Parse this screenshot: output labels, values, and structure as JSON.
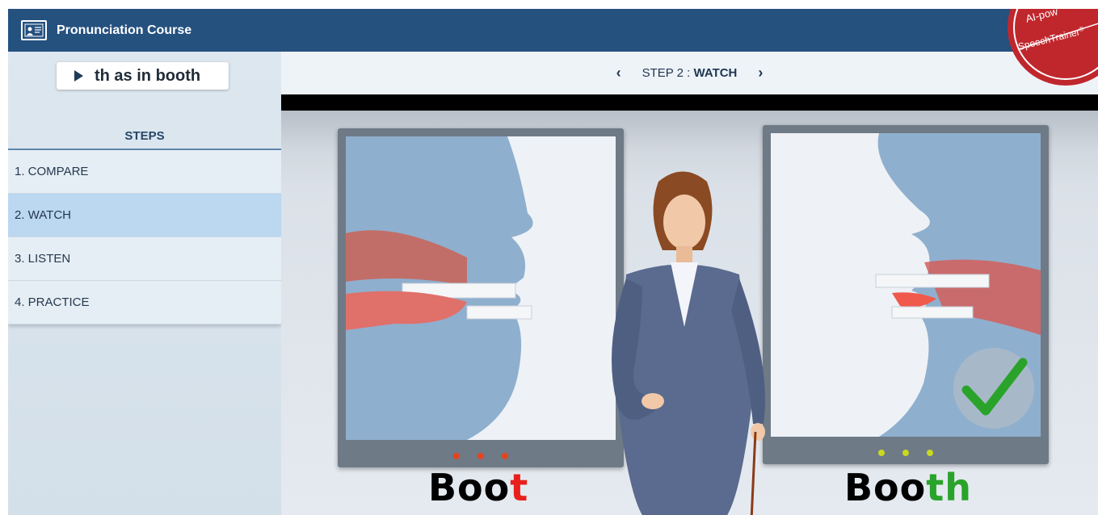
{
  "app": {
    "title": "Pronunciation Course"
  },
  "lesson": {
    "word_button_label": "th as in booth"
  },
  "sidebar": {
    "steps_heading": "STEPS",
    "steps": [
      {
        "label": "1. COMPARE",
        "active": false
      },
      {
        "label": "2. WATCH",
        "active": true
      },
      {
        "label": "3. LISTEN",
        "active": false
      },
      {
        "label": "4. PRACTICE",
        "active": false
      }
    ]
  },
  "step_nav": {
    "prev_icon": "chevron-left-icon",
    "next_icon": "chevron-right-icon",
    "prefix": "STEP 2 : ",
    "current": "WATCH"
  },
  "video": {
    "left_word_stem": "Boo",
    "left_word_end": "t",
    "right_word_stem": "Boo",
    "right_word_end": "th",
    "left_dots_color": "#e2451f",
    "right_dots_color": "#c9d91f",
    "wrong_color": "#e8201b",
    "correct_color": "#2aa32a"
  },
  "badge": {
    "top_text": "AI-pow",
    "brand_text": "SpeechTrainer",
    "registered": "®",
    "color": "#c0272d"
  },
  "colors": {
    "titlebar": "#25517f",
    "active_step": "#bcd7f0"
  }
}
